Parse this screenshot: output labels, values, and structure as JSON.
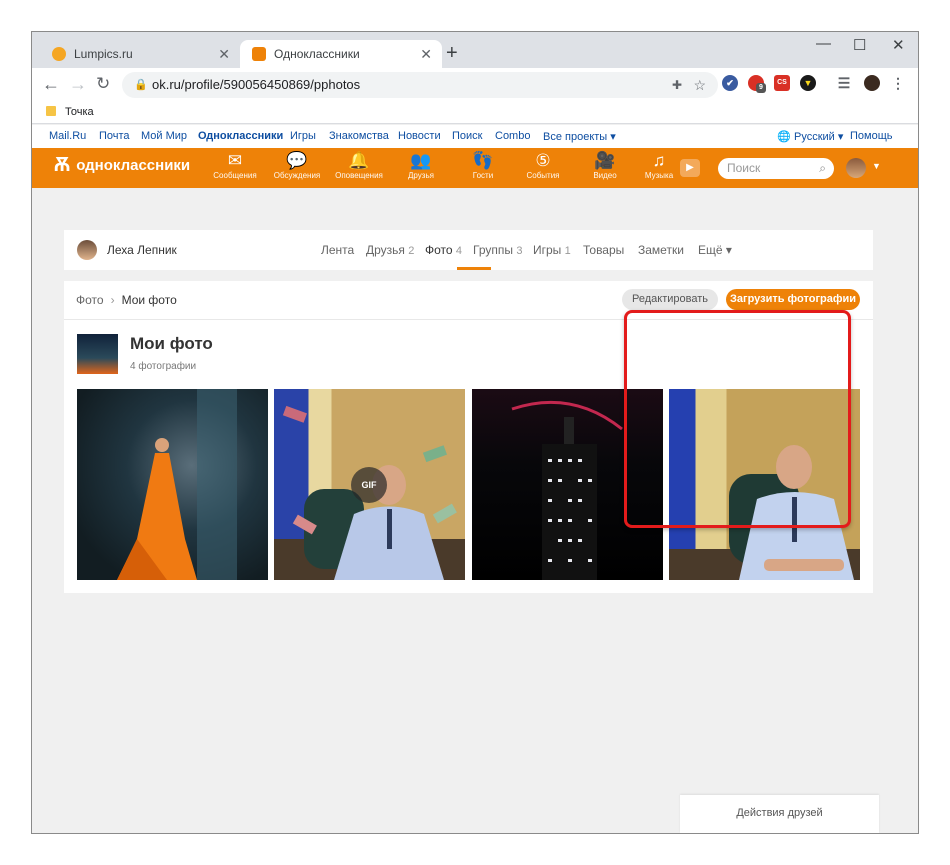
{
  "browser": {
    "tabs": [
      {
        "title": "Lumpics.ru",
        "favicon_color": "#f5a623",
        "active": false
      },
      {
        "title": "Одноклассники",
        "favicon_color": "#ee8208",
        "active": true
      }
    ],
    "new_tab_glyph": "+",
    "window_controls": {
      "minimize": "—",
      "maximize": "☐",
      "close": "✕"
    },
    "url": "ok.ru/profile/590056450869/pphotos",
    "bookmarks": [
      {
        "label": "Точка"
      }
    ],
    "extension_badge": "9"
  },
  "ok_top_links": [
    "Mail.Ru",
    "Почта",
    "Мой Мир",
    "Одноклассники",
    "Игры",
    "Знакомства",
    "Новости",
    "Поиск",
    "Combo",
    "Все проекты ▾"
  ],
  "ok_top_right": {
    "language": "Русский ▾",
    "help": "Помощь"
  },
  "ok_header": {
    "logo": "одноклассники",
    "items": [
      {
        "icon": "✉",
        "label": "Сообщения"
      },
      {
        "icon": "💬",
        "label": "Обсуждения"
      },
      {
        "icon": "🔔",
        "label": "Оповещения"
      },
      {
        "icon": "👥",
        "label": "Друзья"
      },
      {
        "icon": "👣",
        "label": "Гости"
      },
      {
        "icon": "⑤",
        "label": "События"
      },
      {
        "icon": "🎥",
        "label": "Видео"
      },
      {
        "icon": "♫",
        "label": "Музыка"
      }
    ],
    "search_placeholder": "Поиск"
  },
  "profile_nav": {
    "name": "Леха Лепник",
    "tabs": [
      {
        "label": "Лента",
        "count": ""
      },
      {
        "label": "Друзья",
        "count": "2"
      },
      {
        "label": "Фото",
        "count": "4"
      },
      {
        "label": "Группы",
        "count": "3"
      },
      {
        "label": "Игры",
        "count": "1"
      },
      {
        "label": "Товары",
        "count": ""
      },
      {
        "label": "Заметки",
        "count": ""
      },
      {
        "label": "Ещё ▾",
        "count": ""
      }
    ],
    "active_tab": "Фото"
  },
  "album": {
    "breadcrumbs": [
      "Фото",
      "Мои фото"
    ],
    "edit_button": "Редактировать",
    "upload_button": "Загрузить фотографии",
    "title": "Мои фото",
    "count": "4 фотографии",
    "gif_badge": "GIF"
  },
  "footer": {
    "friends_actions": "Действия друзей"
  },
  "colors": {
    "ok_orange": "#ee8208",
    "highlight_red": "#e31b1b"
  }
}
